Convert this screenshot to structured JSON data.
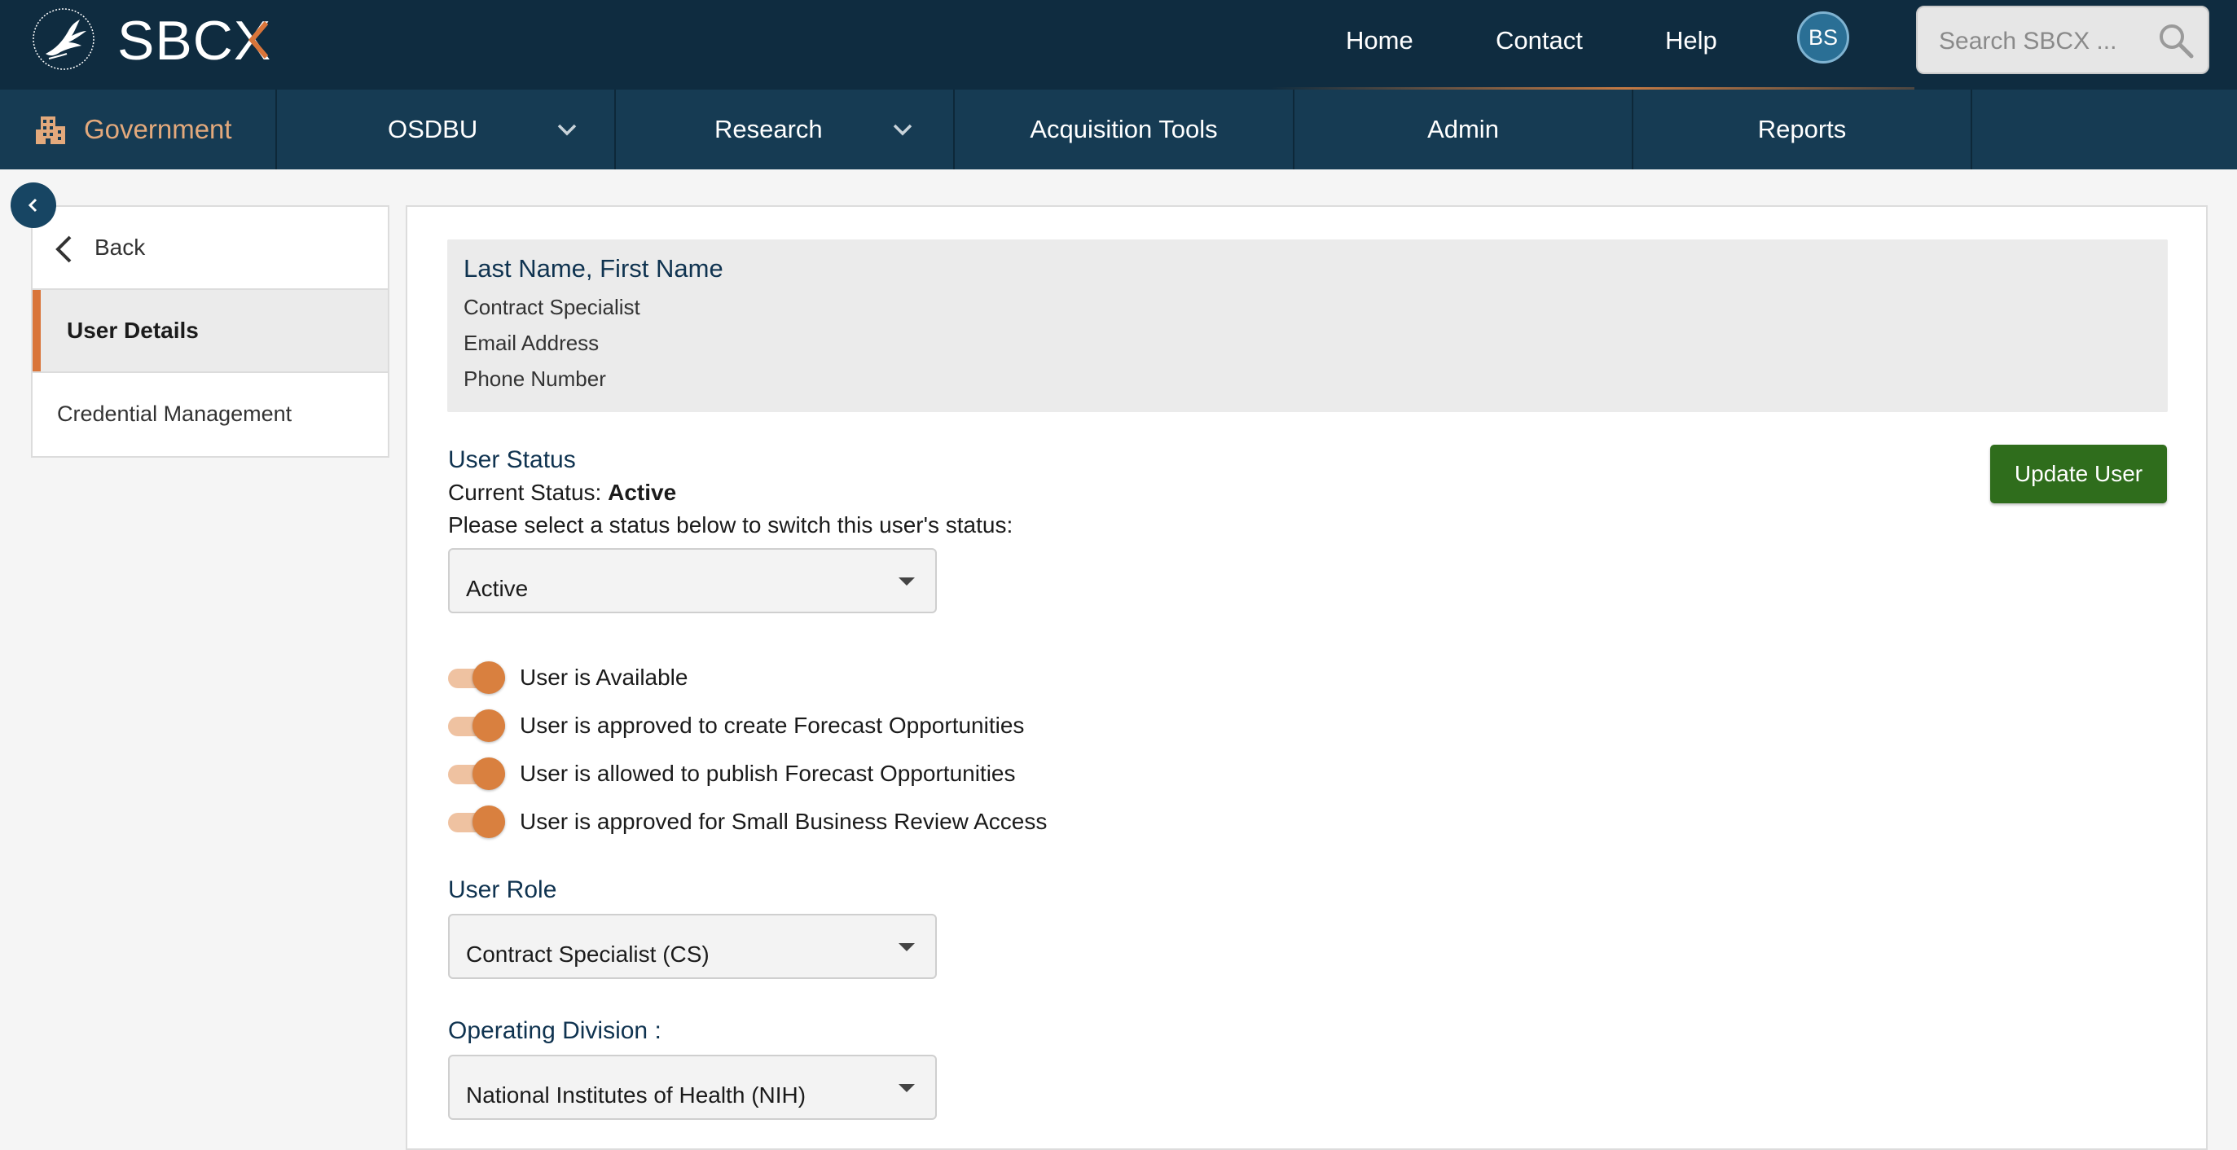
{
  "header": {
    "logo_text": "SBCX",
    "nav": [
      "Home",
      "Contact",
      "Help"
    ],
    "avatar_initials": "BS",
    "search_placeholder": "Search SBCX ..."
  },
  "subnav": {
    "portal_label": "Government",
    "items": [
      {
        "label": "OSDBU",
        "dropdown": true
      },
      {
        "label": "Research",
        "dropdown": true
      },
      {
        "label": "Acquisition Tools",
        "dropdown": false
      },
      {
        "label": "Admin",
        "dropdown": false
      },
      {
        "label": "Reports",
        "dropdown": false
      }
    ]
  },
  "sidebar": {
    "back_label": "Back",
    "items": [
      "User Details",
      "Credential Management"
    ],
    "active_item": "User Details"
  },
  "user_info": {
    "name": "Last Name, First Name",
    "title": "Contract Specialist",
    "email": "Email Address",
    "phone": "Phone Number"
  },
  "status": {
    "heading": "User Status",
    "current_prefix": "Current Status:",
    "current_value": "Active",
    "instruction": "Please select a status below to switch this user's status:",
    "selected": "Active"
  },
  "actions": {
    "update_label": "Update User"
  },
  "toggles": [
    {
      "label": "User is Available",
      "on": true
    },
    {
      "label": "User is approved to create Forecast Opportunities",
      "on": true
    },
    {
      "label": "User is allowed to publish Forecast Opportunities",
      "on": true
    },
    {
      "label": "User is approved for Small Business Review Access",
      "on": true
    }
  ],
  "role": {
    "heading": "User Role",
    "selected": "Contract Specialist (CS)"
  },
  "division": {
    "heading": "Operating Division :",
    "selected": "National Institutes of Health (NIH)"
  },
  "colors": {
    "topbar": "#0f2c40",
    "subnav": "#163b53",
    "accent_orange": "#d9803f",
    "primary_button": "#2f6d1c",
    "heading_blue": "#0f3350"
  }
}
